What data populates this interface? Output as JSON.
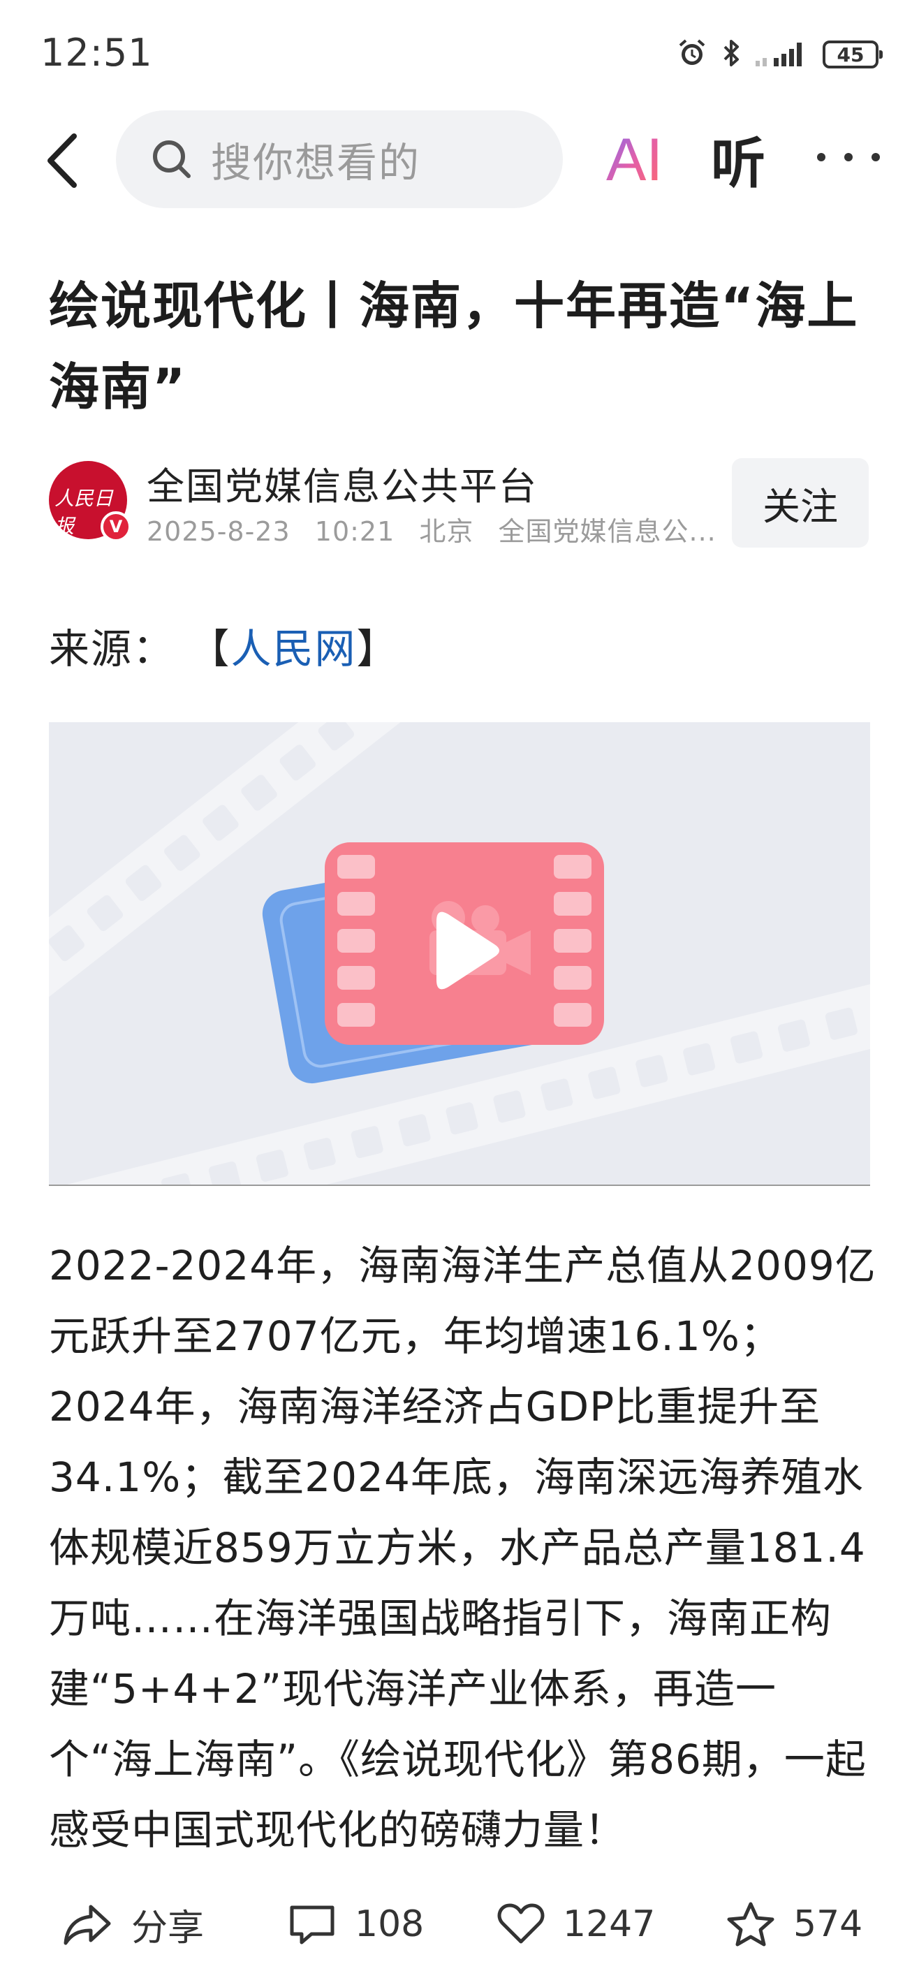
{
  "status_bar": {
    "time": "12:51",
    "battery": "45",
    "icons": [
      "alarm-icon",
      "bluetooth-icon",
      "signal-icon",
      "battery-icon"
    ]
  },
  "top_bar": {
    "search_placeholder": "搜你想看的",
    "ai_label": "AI",
    "listen_label": "听",
    "icons": [
      "back-arrow-icon",
      "search-icon",
      "more-icon"
    ]
  },
  "article": {
    "title": "绘说现代化丨海南，十年再造“海上海南”",
    "author": {
      "name": "全国党媒信息公共平台",
      "date": "2025-8-23",
      "time": "10:21",
      "location": "北京",
      "source_short": "全国党媒信息公...",
      "avatar_text": "人民日报",
      "verified_label": "V",
      "follow_label": "关注"
    },
    "source_prefix": "来源：",
    "source_bracket_open": "【",
    "source_name": "人民网",
    "source_bracket_close": "】",
    "body": "2022-2024年，海南海洋生产总值从2009亿元跃升至2707亿元，年均增速16.1%；2024年，海南海洋经济占GDP比重提升至34.1%；截至2024年底，海南深远海养殖水体规模近859万立方米，水产品总产量181.4万吨……在海洋强国战略指引下，海南正构建“5+4+2”现代海洋产业体系，再造一个“海上海南”。《绘说现代化》第86期，一起感受中国式现代化的磅礴力量！"
  },
  "actions": {
    "share_label": "分享",
    "comments_count": "108",
    "likes_count": "1247",
    "favorites_count": "574"
  },
  "colors": {
    "accent_link": "#1a5fb4",
    "avatar_red": "#c8102e",
    "video_bg": "#e9ebf1",
    "video_film": "#f7808f",
    "video_card": "#6ea2ea"
  }
}
